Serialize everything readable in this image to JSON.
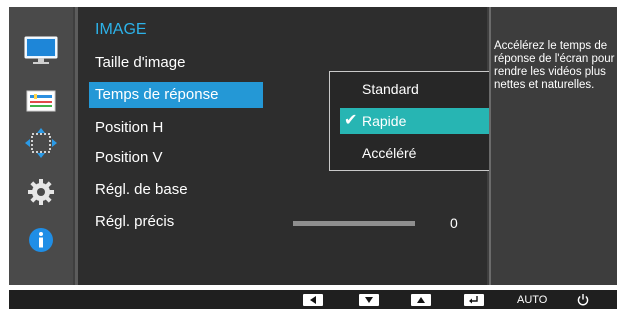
{
  "menu": {
    "title": "IMAGE",
    "items": [
      {
        "label": "Taille d'image"
      },
      {
        "label": "Temps de réponse"
      },
      {
        "label": "Position H"
      },
      {
        "label": "Position V"
      },
      {
        "label": "Régl. de base"
      },
      {
        "label": "Régl. précis"
      }
    ],
    "selected_index": 1
  },
  "submenu": {
    "options": [
      "Standard",
      "Rapide",
      "Accéléré"
    ],
    "selected": "Rapide",
    "check_glyph": "✔"
  },
  "fine_tune": {
    "value": "0"
  },
  "help": {
    "text": "Accélérez le temps de réponse de l'écran pour rendre les vidéos plus nettes et naturelles."
  },
  "sidebar": {
    "icons": [
      "monitor-icon",
      "picture-adjust-icon",
      "position-arrows-icon",
      "gear-icon",
      "info-icon"
    ]
  },
  "bottom_bar": {
    "auto_label": "AUTO",
    "buttons": [
      "left-arrow-icon",
      "down-arrow-icon",
      "up-arrow-icon",
      "enter-icon",
      "auto-button",
      "power-icon"
    ]
  },
  "colors": {
    "title_accent": "#2db2e9",
    "selected_item": "#2498d6",
    "selected_option": "#27b5b3",
    "osd_background": "#3f3f3f"
  }
}
